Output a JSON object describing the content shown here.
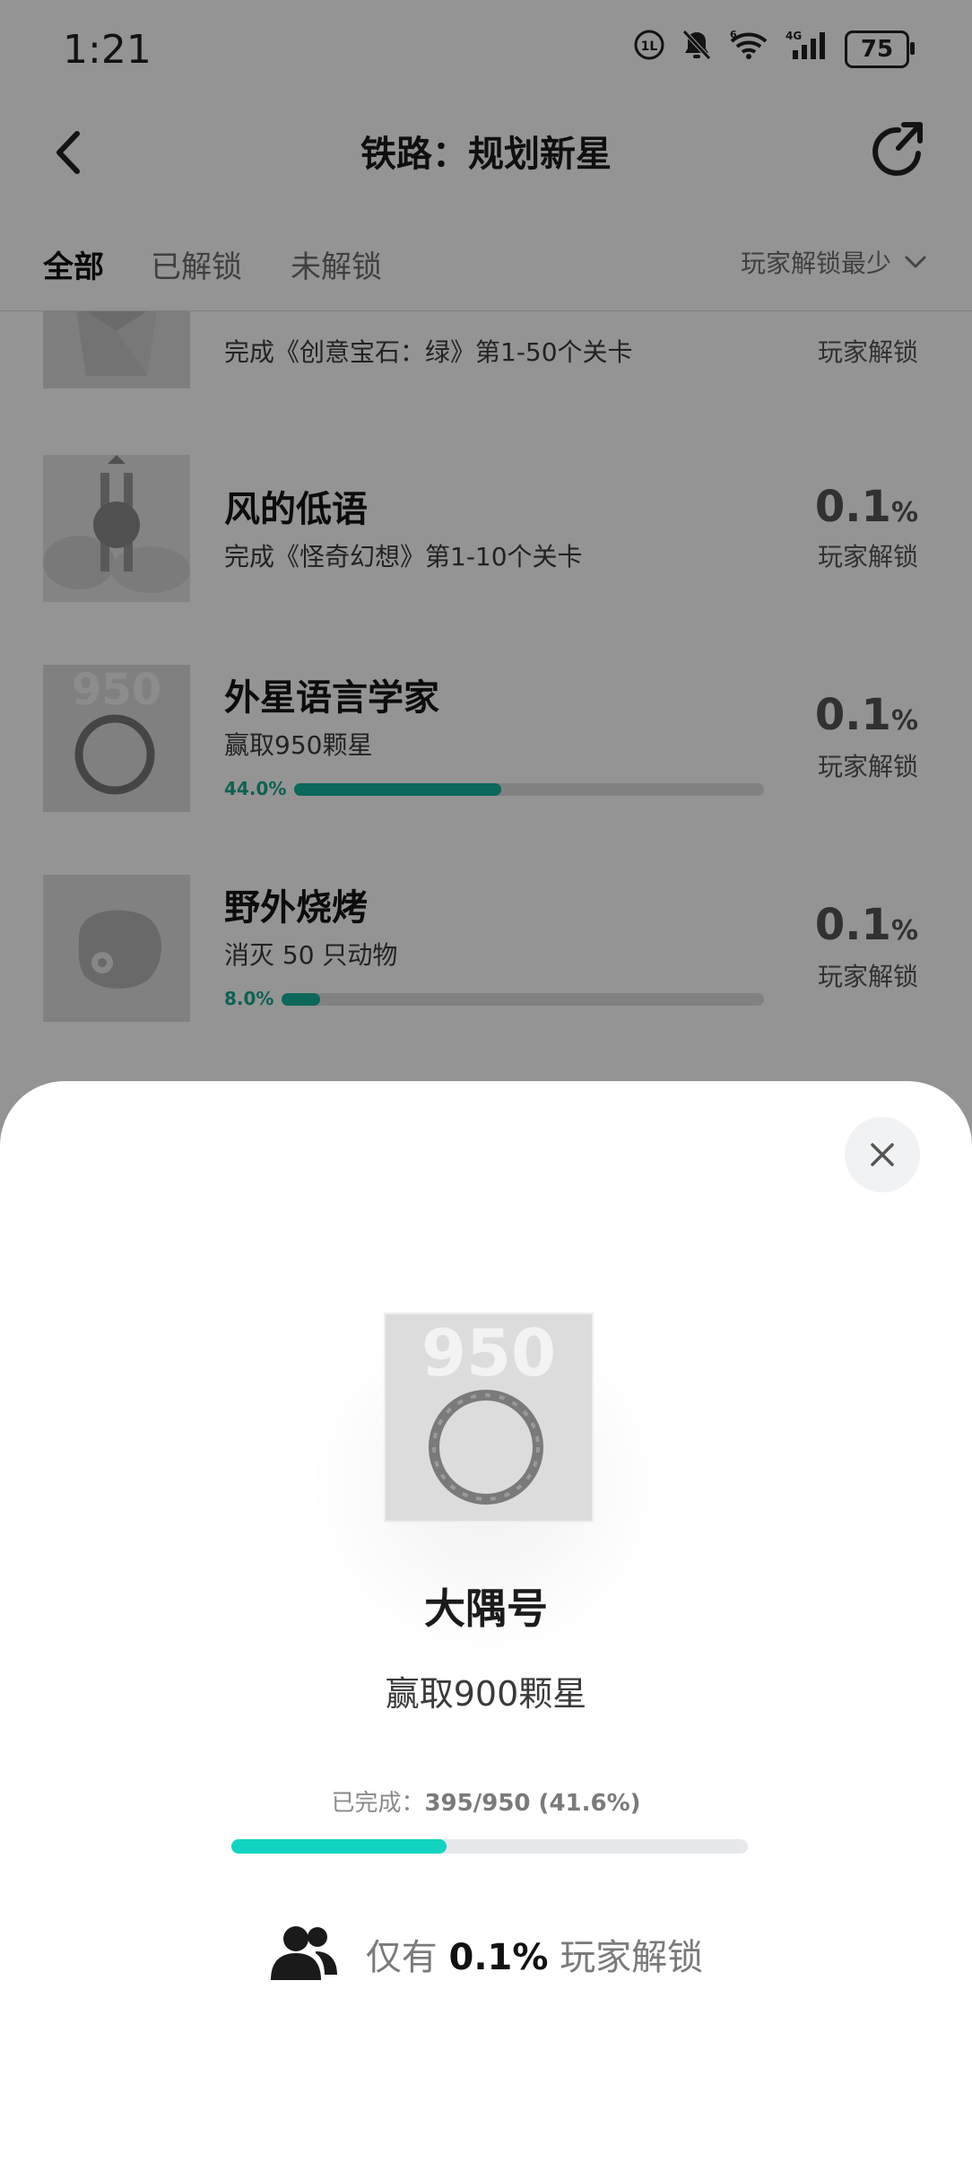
{
  "status_bar": {
    "time": "1:21",
    "battery": "75",
    "icons": [
      "hd-call-icon",
      "mute-bell-icon",
      "wifi-6-icon",
      "4g-signal-icon",
      "battery-icon"
    ]
  },
  "header": {
    "title": "铁路：规划新星",
    "back_icon": "chevron-left-icon",
    "share_icon": "share-icon"
  },
  "tabs": {
    "items": [
      {
        "label": "全部",
        "active": true
      },
      {
        "label": "已解锁",
        "active": false
      },
      {
        "label": "未解锁",
        "active": false
      }
    ],
    "sort_label": "玩家解锁最少",
    "sort_icon": "chevron-down-icon"
  },
  "achievements": [
    {
      "name": "",
      "desc": "完成《创意宝石：绿》第1-50个关卡",
      "percent": "",
      "unlock_label": "玩家解锁"
    },
    {
      "name": "风的低语",
      "desc": "完成《怪奇幻想》第1-10个关卡",
      "percent": "0.1",
      "unit": "%",
      "unlock_label": "玩家解锁"
    },
    {
      "name": "外星语言学家",
      "desc": "赢取950颗星",
      "progress_label": "44.0%",
      "progress": 0.44,
      "percent": "0.1",
      "unit": "%",
      "unlock_label": "玩家解锁"
    },
    {
      "name": "野外烧烤",
      "desc": "消灭 50 只动物",
      "progress_label": "8.0%",
      "progress": 0.08,
      "percent": "0.1",
      "unit": "%",
      "unlock_label": "玩家解锁"
    }
  ],
  "sheet": {
    "close_icon": "close-icon",
    "icon_text": "950",
    "title": "大隅号",
    "description": "赢取900颗星",
    "progress_prefix": "已完成：",
    "progress_text": "395/950 (41.6%)",
    "progress": 0.416,
    "rarity_prefix": "仅有",
    "rarity_percent": "0.1%",
    "rarity_suffix": "玩家解锁",
    "rarity_icon": "users-icon"
  },
  "colors": {
    "accent": "#12d3bf",
    "list_progress": "#14b39b",
    "overlay": "rgba(0,0,0,0.42)"
  }
}
